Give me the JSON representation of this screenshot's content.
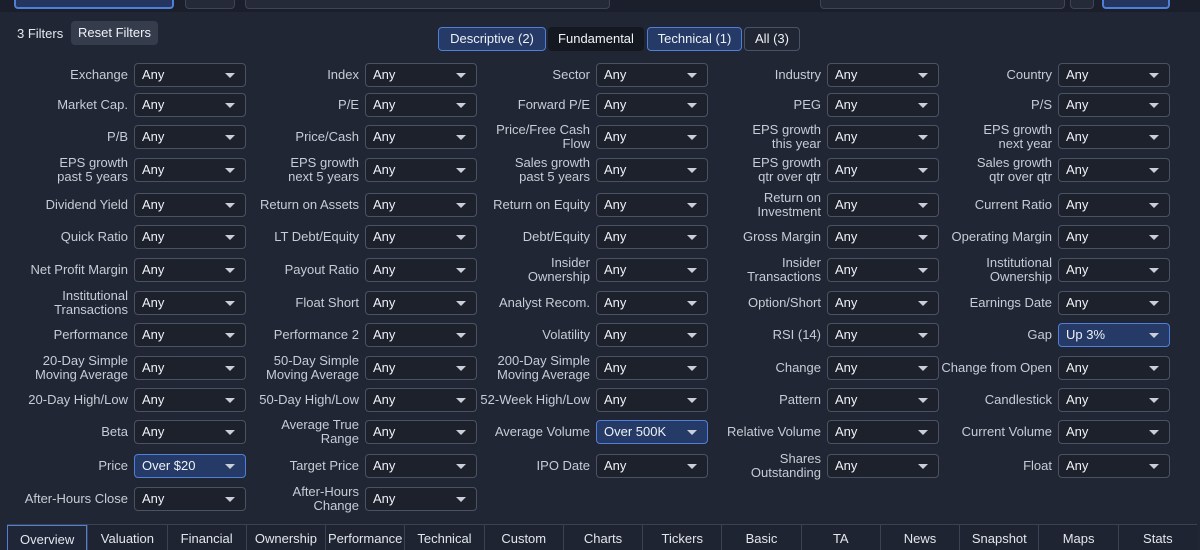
{
  "filter_count": "3 Filters",
  "reset_label": "Reset Filters",
  "tabs": [
    {
      "label": "Descriptive (2)"
    },
    {
      "label": "Fundamental"
    },
    {
      "label": "Technical (1)"
    },
    {
      "label": "All (3)"
    }
  ],
  "filters": [
    {
      "label": "Exchange",
      "value": "Any"
    },
    {
      "label": "Index",
      "value": "Any"
    },
    {
      "label": "Sector",
      "value": "Any"
    },
    {
      "label": "Industry",
      "value": "Any"
    },
    {
      "label": "Country",
      "value": "Any"
    },
    {
      "label": "Market Cap.",
      "value": "Any"
    },
    {
      "label": "P/E",
      "value": "Any"
    },
    {
      "label": "Forward P/E",
      "value": "Any"
    },
    {
      "label": "PEG",
      "value": "Any"
    },
    {
      "label": "P/S",
      "value": "Any"
    },
    {
      "label": "P/B",
      "value": "Any"
    },
    {
      "label": "Price/Cash",
      "value": "Any"
    },
    {
      "label": "Price/Free Cash\nFlow",
      "value": "Any"
    },
    {
      "label": "EPS growth\nthis year",
      "value": "Any"
    },
    {
      "label": "EPS growth\nnext year",
      "value": "Any"
    },
    {
      "label": "EPS growth\npast 5 years",
      "value": "Any"
    },
    {
      "label": "EPS growth\nnext 5 years",
      "value": "Any"
    },
    {
      "label": "Sales growth\npast 5 years",
      "value": "Any"
    },
    {
      "label": "EPS growth\nqtr over qtr",
      "value": "Any"
    },
    {
      "label": "Sales growth\nqtr over qtr",
      "value": "Any"
    },
    {
      "label": "Dividend Yield",
      "value": "Any"
    },
    {
      "label": "Return on Assets",
      "value": "Any"
    },
    {
      "label": "Return on Equity",
      "value": "Any"
    },
    {
      "label": "Return on\nInvestment",
      "value": "Any"
    },
    {
      "label": "Current Ratio",
      "value": "Any"
    },
    {
      "label": "Quick Ratio",
      "value": "Any"
    },
    {
      "label": "LT Debt/Equity",
      "value": "Any"
    },
    {
      "label": "Debt/Equity",
      "value": "Any"
    },
    {
      "label": "Gross Margin",
      "value": "Any"
    },
    {
      "label": "Operating Margin",
      "value": "Any"
    },
    {
      "label": "Net Profit Margin",
      "value": "Any"
    },
    {
      "label": "Payout Ratio",
      "value": "Any"
    },
    {
      "label": "Insider\nOwnership",
      "value": "Any"
    },
    {
      "label": "Insider\nTransactions",
      "value": "Any"
    },
    {
      "label": "Institutional\nOwnership",
      "value": "Any"
    },
    {
      "label": "Institutional\nTransactions",
      "value": "Any"
    },
    {
      "label": "Float Short",
      "value": "Any"
    },
    {
      "label": "Analyst Recom.",
      "value": "Any"
    },
    {
      "label": "Option/Short",
      "value": "Any"
    },
    {
      "label": "Earnings Date",
      "value": "Any"
    },
    {
      "label": "Performance",
      "value": "Any"
    },
    {
      "label": "Performance 2",
      "value": "Any"
    },
    {
      "label": "Volatility",
      "value": "Any"
    },
    {
      "label": "RSI (14)",
      "value": "Any"
    },
    {
      "label": "Gap",
      "value": "Up 3%",
      "active": true
    },
    {
      "label": "20-Day Simple\nMoving Average",
      "value": "Any"
    },
    {
      "label": "50-Day Simple\nMoving Average",
      "value": "Any"
    },
    {
      "label": "200-Day Simple\nMoving Average",
      "value": "Any"
    },
    {
      "label": "Change",
      "value": "Any"
    },
    {
      "label": "Change from Open",
      "value": "Any"
    },
    {
      "label": "20-Day High/Low",
      "value": "Any"
    },
    {
      "label": "50-Day High/Low",
      "value": "Any"
    },
    {
      "label": "52-Week High/Low",
      "value": "Any"
    },
    {
      "label": "Pattern",
      "value": "Any"
    },
    {
      "label": "Candlestick",
      "value": "Any"
    },
    {
      "label": "Beta",
      "value": "Any"
    },
    {
      "label": "Average True\nRange",
      "value": "Any"
    },
    {
      "label": "Average Volume",
      "value": "Over 500K",
      "active": true
    },
    {
      "label": "Relative Volume",
      "value": "Any"
    },
    {
      "label": "Current Volume",
      "value": "Any"
    },
    {
      "label": "Price",
      "value": "Over $20",
      "active": true
    },
    {
      "label": "Target Price",
      "value": "Any"
    },
    {
      "label": "IPO Date",
      "value": "Any"
    },
    {
      "label": "Shares\nOutstanding",
      "value": "Any"
    },
    {
      "label": "Float",
      "value": "Any"
    },
    {
      "label": "After-Hours Close",
      "value": "Any"
    },
    {
      "label": "After-Hours\nChange",
      "value": "Any"
    }
  ],
  "view_tabs": [
    "Overview",
    "Valuation",
    "Financial",
    "Ownership",
    "Performance",
    "Technical",
    "Custom",
    "Charts",
    "Tickers",
    "Basic",
    "TA",
    "News",
    "Snapshot",
    "Maps",
    "Stats"
  ]
}
